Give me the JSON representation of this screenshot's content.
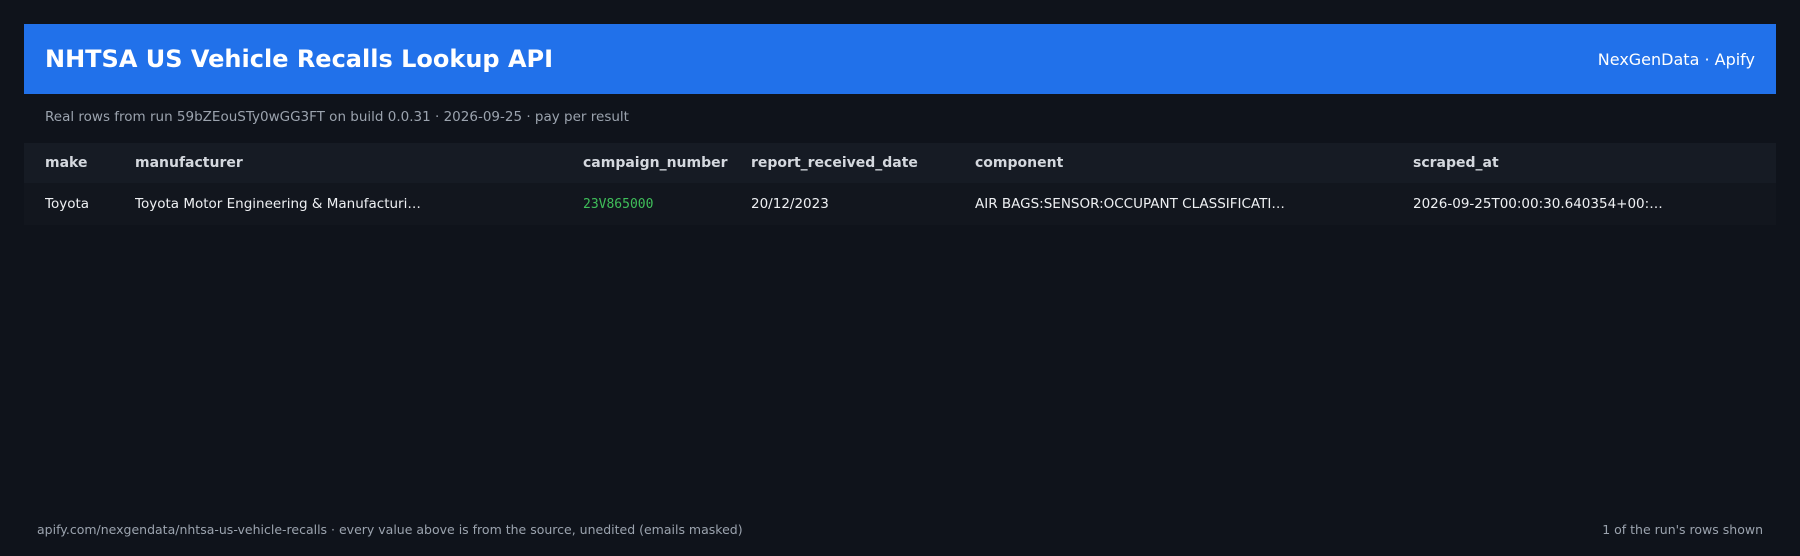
{
  "header": {
    "title": "NHTSA US Vehicle Recalls Lookup API",
    "brand": "NexGenData · Apify"
  },
  "subtitle": "Real rows from run 59bZEouSTy0wGG3FT on build 0.0.31 · 2026-09-25 · pay per result",
  "table": {
    "columns": [
      "make",
      "manufacturer",
      "campaign_number",
      "report_received_date",
      "component",
      "scraped_at"
    ],
    "rows": [
      {
        "make": "Toyota",
        "manufacturer": "Toyota Motor Engineering & Manufacturi…",
        "campaign_number": "23V865000",
        "report_received_date": "20/12/2023",
        "component": "AIR BAGS:SENSOR:OCCUPANT CLASSIFICATI…",
        "scraped_at": "2026-09-25T00:00:30.640354+00:…"
      }
    ]
  },
  "footer": {
    "left": "apify.com/nexgendata/nhtsa-us-vehicle-recalls  ·  every value above is from the source, unedited (emails masked)",
    "right": "1 of the run's rows shown"
  },
  "colors": {
    "background": "#0f131b",
    "header": "#2171ea",
    "accent_code": "#3fbf5a"
  }
}
